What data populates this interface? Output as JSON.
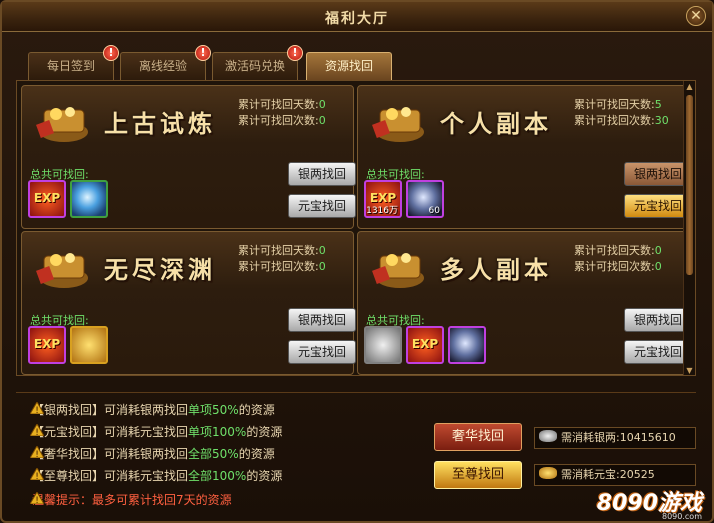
{
  "window": {
    "title": "福利大厅",
    "close_icon": "close-icon"
  },
  "tabs": [
    {
      "label": "每日签到",
      "alert": "!"
    },
    {
      "label": "离线经验",
      "alert": "!"
    },
    {
      "label": "激活码兑换",
      "alert": "!"
    },
    {
      "label": "资源找回",
      "active": true
    }
  ],
  "cards": [
    {
      "title": "上古试炼",
      "days_label": "累计可找回天数:",
      "days": "0",
      "times_label": "累计可找回次数:",
      "times": "0",
      "total_label": "总共可找回:",
      "silver_btn": "银两找回",
      "gold_btn": "元宝找回",
      "items": [
        {
          "icon": "exp-icon",
          "text": "EXP",
          "qty": ""
        },
        {
          "icon": "blue-orb-icon",
          "text": "",
          "qty": ""
        }
      ]
    },
    {
      "title": "个人副本",
      "days_label": "累计可找回天数:",
      "days": "5",
      "times_label": "累计可找回次数:",
      "times": "30",
      "total_label": "总共可找回:",
      "silver_btn": "银两找回",
      "gold_btn": "元宝找回",
      "items": [
        {
          "icon": "exp-icon",
          "text": "EXP",
          "qty": "1316万"
        },
        {
          "icon": "silver-orb-icon",
          "text": "",
          "qty": "60"
        }
      ]
    },
    {
      "title": "无尽深渊",
      "days_label": "累计可找回天数:",
      "days": "0",
      "times_label": "累计可找回次数:",
      "times": "0",
      "total_label": "总共可找回:",
      "silver_btn": "银两找回",
      "gold_btn": "元宝找回",
      "items": [
        {
          "icon": "exp-icon",
          "text": "EXP",
          "qty": ""
        },
        {
          "icon": "gold-ingot-icon",
          "text": "",
          "qty": ""
        }
      ]
    },
    {
      "title": "多人副本",
      "days_label": "累计可找回天数:",
      "days": "0",
      "times_label": "累计可找回次数:",
      "times": "0",
      "total_label": "总共可找回:",
      "silver_btn": "银两找回",
      "gold_btn": "元宝找回",
      "items": [
        {
          "icon": "silver-ingot-icon",
          "text": "",
          "qty": ""
        },
        {
          "icon": "exp-icon",
          "text": "EXP",
          "qty": ""
        },
        {
          "icon": "silver-orb-icon",
          "text": "",
          "qty": ""
        }
      ]
    }
  ],
  "notes": [
    {
      "pre": "【银两找回】可消耗银两找回",
      "hl": "单项50%",
      "post": "的资源"
    },
    {
      "pre": "【元宝找回】可消耗元宝找回",
      "hl": "单项100%",
      "post": "的资源"
    },
    {
      "pre": "【奢华找回】可消耗银两找回",
      "hl": "全部50%",
      "post": "的资源"
    },
    {
      "pre": "【至尊找回】可消耗元宝找回",
      "hl": "全部100%",
      "post": "的资源"
    }
  ],
  "tip": "温馨提示：最多可累计找回7天的资源",
  "luxury_btn": "奢华找回",
  "supreme_btn": "至尊找回",
  "cost_silver": "需消耗银两:10415610",
  "cost_gold": "需消耗元宝:20525",
  "watermark": "8090游戏",
  "watermark_sub": "8090.com",
  "colors": {
    "highlight": "#6fe06a",
    "tip": "#ff6040",
    "accent_gold": "#f7e0a8"
  }
}
